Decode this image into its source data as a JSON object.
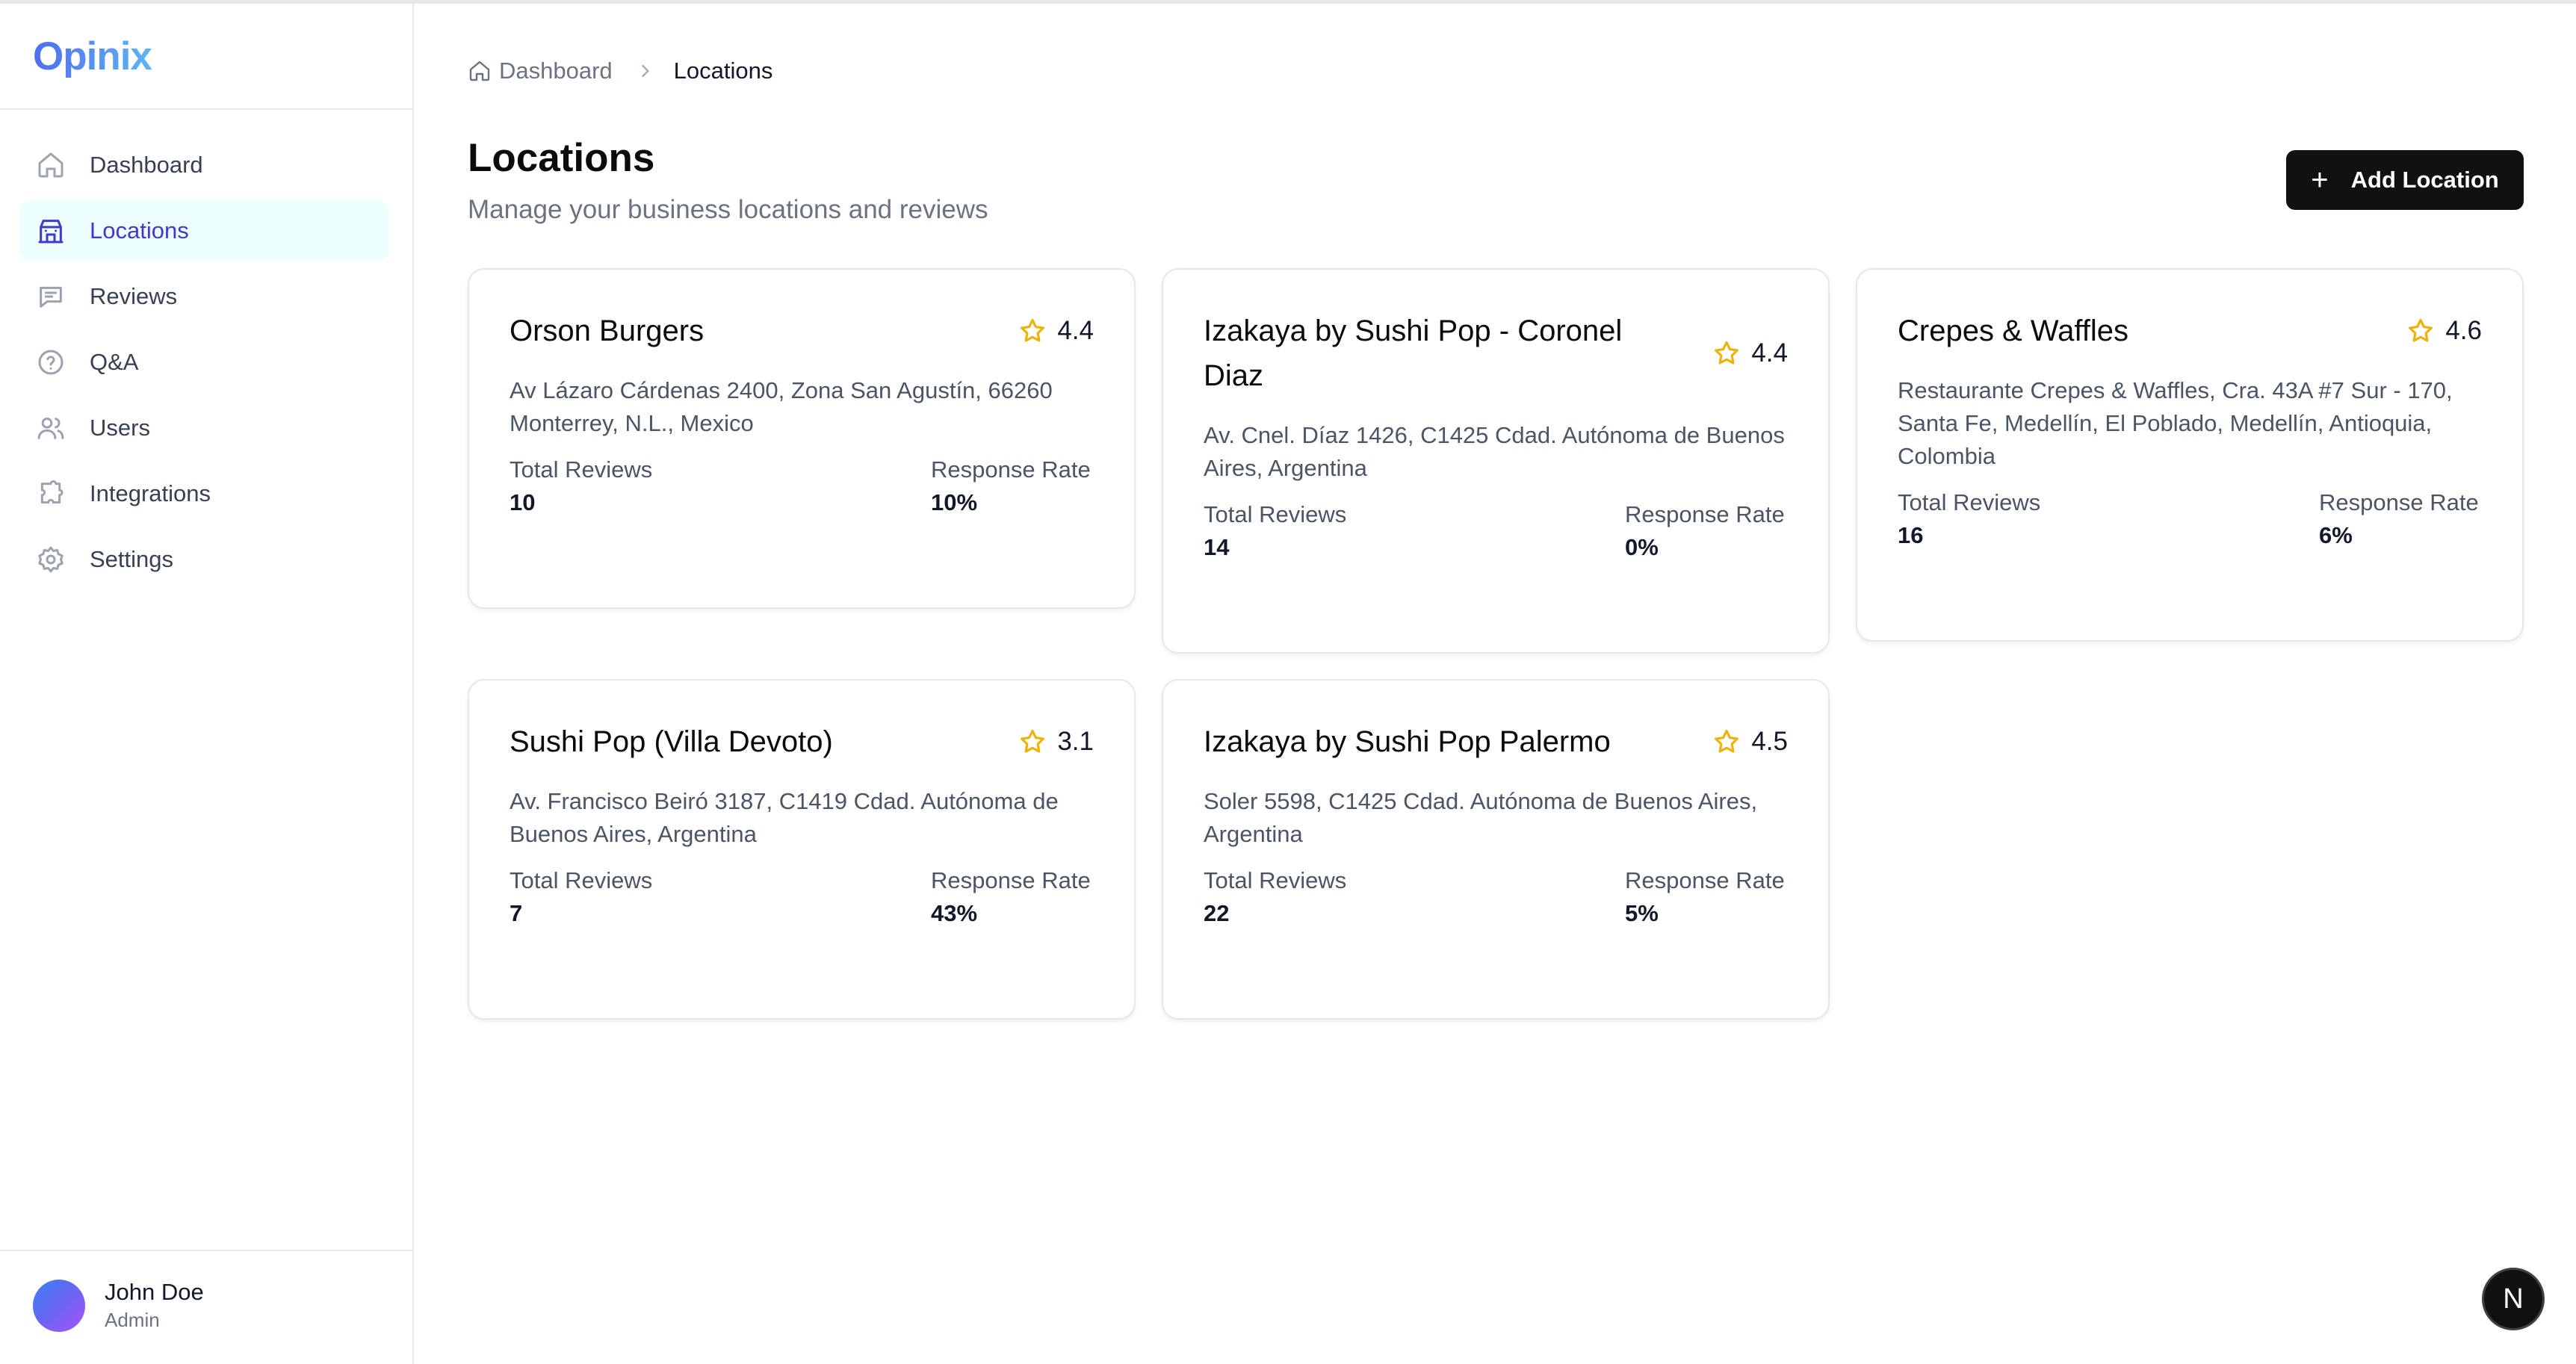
{
  "app": {
    "logo": "Opinix"
  },
  "sidebar": {
    "items": [
      {
        "label": "Dashboard",
        "icon": "home-icon"
      },
      {
        "label": "Locations",
        "icon": "building-icon",
        "active": true
      },
      {
        "label": "Reviews",
        "icon": "message-icon"
      },
      {
        "label": "Q&A",
        "icon": "help-circle-icon"
      },
      {
        "label": "Users",
        "icon": "users-icon"
      },
      {
        "label": "Integrations",
        "icon": "puzzle-icon"
      },
      {
        "label": "Settings",
        "icon": "gear-icon"
      }
    ],
    "user": {
      "name": "John Doe",
      "role": "Admin"
    }
  },
  "breadcrumb": {
    "home": "Dashboard",
    "current": "Locations"
  },
  "header": {
    "title": "Locations",
    "subtitle": "Manage your business locations and reviews",
    "add_button": "Add Location"
  },
  "stats_labels": {
    "total_reviews": "Total Reviews",
    "response_rate": "Response Rate"
  },
  "locations": [
    {
      "name": "Orson Burgers",
      "rating": "4.4",
      "address": "Av Lázaro Cárdenas 2400, Zona San Agustín, 66260 Monterrey, N.L., Mexico",
      "total_reviews": "10",
      "response_rate": "10%"
    },
    {
      "name": "Izakaya by Sushi Pop - Coronel Diaz",
      "rating": "4.4",
      "address": "Av. Cnel. Díaz 1426, C1425 Cdad. Autónoma de Buenos Aires, Argentina",
      "total_reviews": "14",
      "response_rate": "0%"
    },
    {
      "name": "Crepes & Waffles",
      "rating": "4.6",
      "address": "Restaurante Crepes & Waffles, Cra. 43A #7 Sur - 170, Santa Fe, Medellín, El Poblado, Medellín, Antioquia, Colombia",
      "total_reviews": "16",
      "response_rate": "6%"
    },
    {
      "name": "Sushi Pop (Villa Devoto)",
      "rating": "3.1",
      "address": "Av. Francisco Beiró 3187, C1419 Cdad. Autónoma de Buenos Aires, Argentina",
      "total_reviews": "7",
      "response_rate": "43%"
    },
    {
      "name": "Izakaya by Sushi Pop Palermo",
      "rating": "4.5",
      "address": "Soler 5598, C1425 Cdad. Autónoma de Buenos Aires, Argentina",
      "total_reviews": "22",
      "response_rate": "5%"
    }
  ],
  "dev_badge": "N",
  "colors": {
    "accent": "#4338ca",
    "active_bg": "#ecfeff",
    "star": "#eab308",
    "primary_button": "#111111"
  }
}
